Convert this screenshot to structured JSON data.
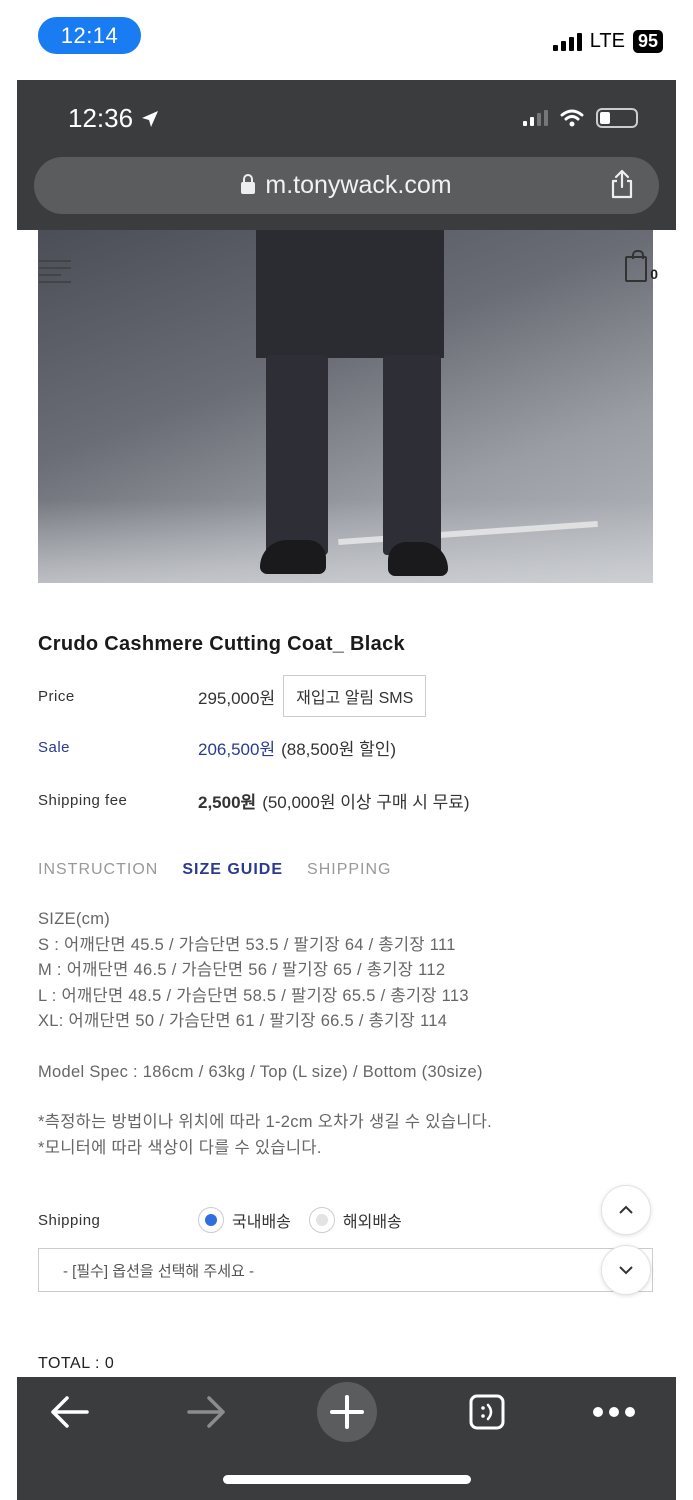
{
  "outer_status": {
    "time": "12:14",
    "network": "LTE",
    "battery": "95"
  },
  "inner_status": {
    "time": "12:36"
  },
  "browser": {
    "url": "m.tonywack.com"
  },
  "header": {
    "cart_count": "0"
  },
  "product": {
    "title": "Crudo Cashmere Cutting Coat_ Black",
    "price_label": "Price",
    "price_value": "295,000원",
    "sms_button": "재입고 알림 SMS",
    "sale_label": "Sale",
    "sale_value": "206,500원",
    "sale_discount": "(88,500원 할인)",
    "shipping_fee_label": "Shipping fee",
    "shipping_fee_value": "2,500원",
    "shipping_fee_note": "(50,000원 이상 구매 시 무료)"
  },
  "tabs": [
    {
      "label": "INSTRUCTION",
      "active": false
    },
    {
      "label": "SIZE GUIDE",
      "active": true
    },
    {
      "label": "SHIPPING",
      "active": false
    }
  ],
  "size_guide": {
    "header": "SIZE(cm)",
    "lines": [
      "S : 어깨단면 45.5 / 가슴단면 53.5 / 팔기장 64 / 총기장 111",
      "M : 어깨단면 46.5 / 가슴단면 56 / 팔기장 65 / 총기장 112",
      "L : 어깨단면 48.5 / 가슴단면 58.5 / 팔기장 65.5 / 총기장 113",
      "XL: 어깨단면 50 / 가슴단면 61 / 팔기장 66.5 / 총기장 114"
    ],
    "model_spec": "Model Spec : 186cm / 63kg / Top (L size) / Bottom (30size)",
    "notes": [
      "*측정하는 방법이나 위치에 따라 1-2cm 오차가 생길 수 있습니다.",
      "*모니터에 따라 색상이 다를 수 있습니다."
    ]
  },
  "shipping_option": {
    "label": "Shipping",
    "domestic": "국내배송",
    "overseas": "해외배송",
    "selected": "domestic"
  },
  "option_select": {
    "placeholder": "- [필수] 옵션을 선택해 주세요 -"
  },
  "total": {
    "text": "TOTAL : 0"
  },
  "colors": {
    "accent": "#2b3a8f",
    "radio": "#2f6fe0",
    "chrome": "#3a3c3e",
    "time_pill": "#1a7cf2"
  }
}
